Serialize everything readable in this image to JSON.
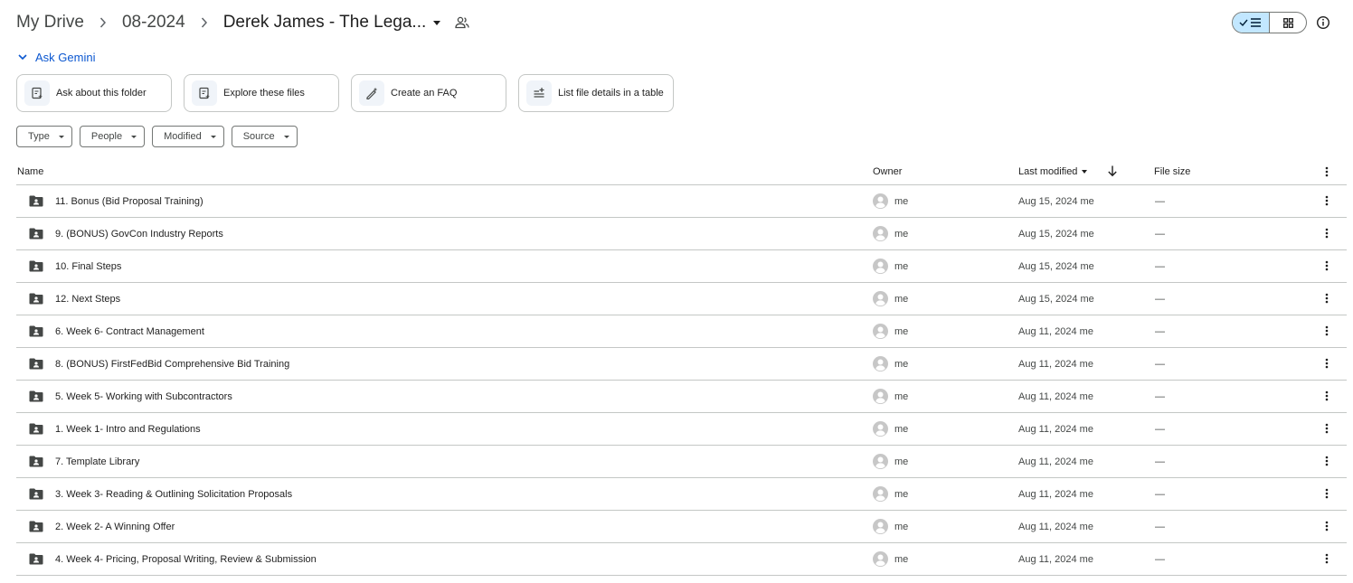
{
  "breadcrumb": {
    "root": "My Drive",
    "parent": "08-2024",
    "current": "Derek James - The Lega..."
  },
  "colors": {
    "accent": "#0b57d0",
    "toggle_active": "#c2e7ff",
    "border": "#c4c7c5"
  },
  "gemini": {
    "label": "Ask Gemini",
    "chips": [
      {
        "label": "Ask about this folder",
        "icon": "doc-ask-icon"
      },
      {
        "label": "Explore these files",
        "icon": "doc-explore-icon"
      },
      {
        "label": "Create an FAQ",
        "icon": "pen-sparkle-icon"
      },
      {
        "label": "List file details in a table",
        "icon": "list-add-icon"
      }
    ]
  },
  "filters": [
    "Type",
    "People",
    "Modified",
    "Source"
  ],
  "table": {
    "columns": {
      "name": "Name",
      "owner": "Owner",
      "modified": "Last modified",
      "size": "File size"
    },
    "rows": [
      {
        "name": "11. Bonus (Bid Proposal Training)",
        "owner": "me",
        "modified": "Aug 15, 2024 me",
        "size": "—"
      },
      {
        "name": "9. (BONUS) GovCon Industry Reports",
        "owner": "me",
        "modified": "Aug 15, 2024 me",
        "size": "—"
      },
      {
        "name": "10. Final Steps",
        "owner": "me",
        "modified": "Aug 15, 2024 me",
        "size": "—"
      },
      {
        "name": "12. Next Steps",
        "owner": "me",
        "modified": "Aug 15, 2024 me",
        "size": "—"
      },
      {
        "name": "6. Week 6- Contract Management",
        "owner": "me",
        "modified": "Aug 11, 2024 me",
        "size": "—"
      },
      {
        "name": "8. (BONUS) FirstFedBid Comprehensive Bid Training",
        "owner": "me",
        "modified": "Aug 11, 2024 me",
        "size": "—"
      },
      {
        "name": "5. Week 5- Working with Subcontractors",
        "owner": "me",
        "modified": "Aug 11, 2024 me",
        "size": "—"
      },
      {
        "name": "1. Week 1- Intro and Regulations",
        "owner": "me",
        "modified": "Aug 11, 2024 me",
        "size": "—"
      },
      {
        "name": "7. Template Library",
        "owner": "me",
        "modified": "Aug 11, 2024 me",
        "size": "—"
      },
      {
        "name": "3. Week 3- Reading & Outlining Solicitation Proposals",
        "owner": "me",
        "modified": "Aug 11, 2024 me",
        "size": "—"
      },
      {
        "name": "2. Week 2- A Winning Offer",
        "owner": "me",
        "modified": "Aug 11, 2024 me",
        "size": "—"
      },
      {
        "name": "4. Week 4- Pricing, Proposal Writing, Review & Submission",
        "owner": "me",
        "modified": "Aug 11, 2024 me",
        "size": "—"
      }
    ]
  }
}
